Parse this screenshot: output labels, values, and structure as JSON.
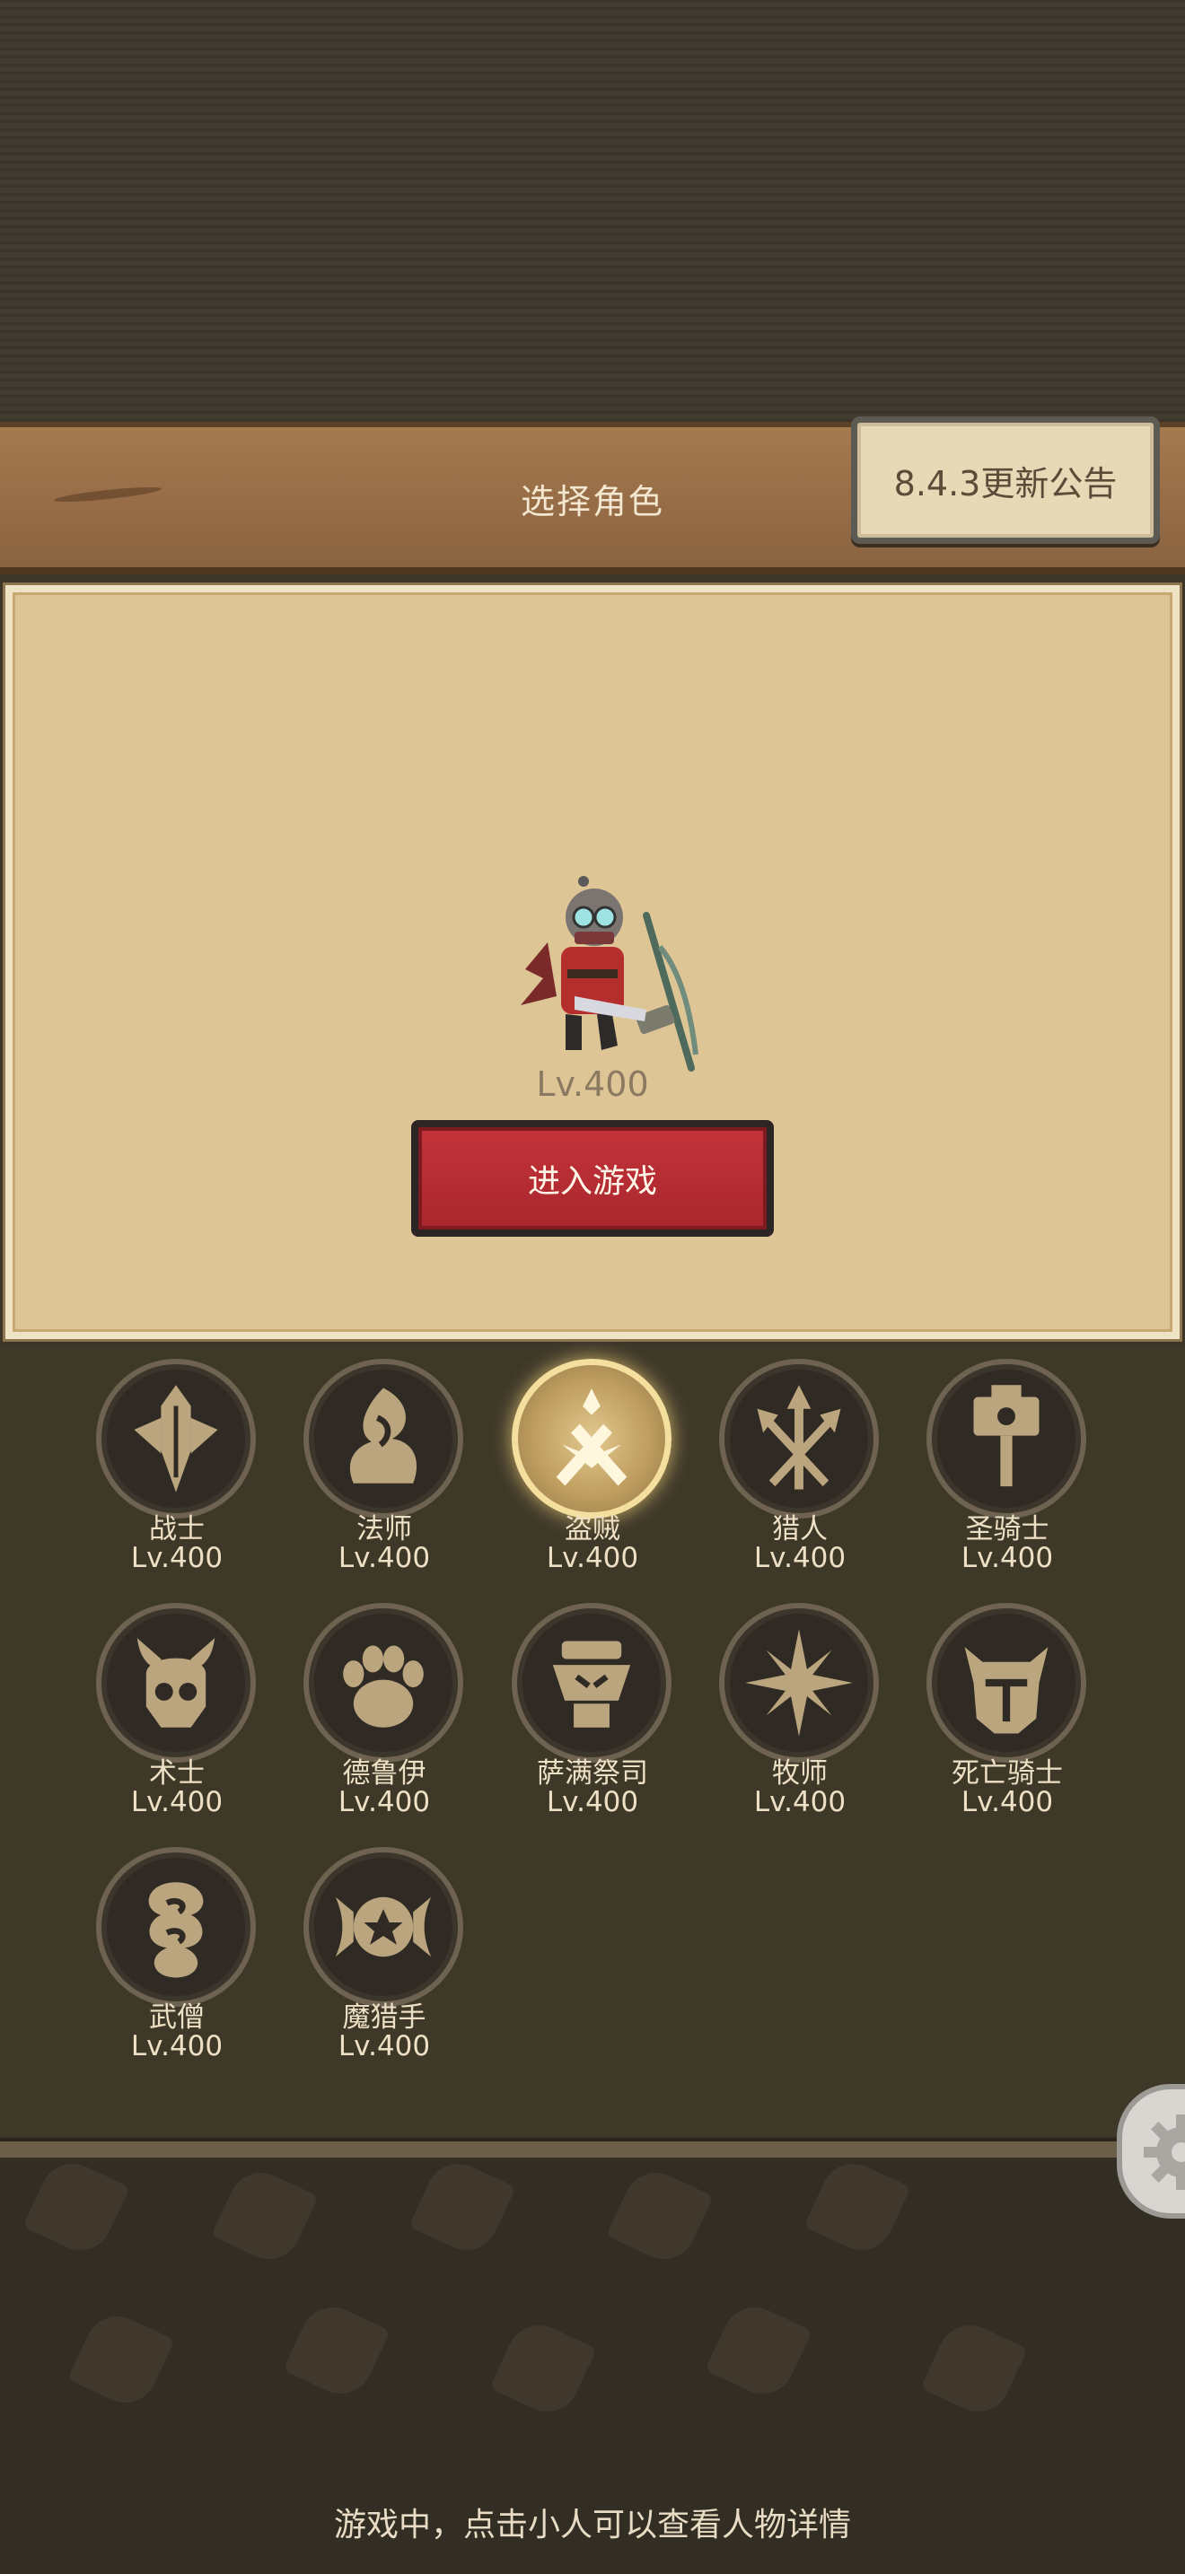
{
  "header": {
    "title": "选择角色",
    "notice_button": "8.4.3更新公告"
  },
  "selected_character": {
    "level": "Lv.400",
    "enter_button": "进入游戏"
  },
  "classes": [
    {
      "name": "战士",
      "level": "Lv.400",
      "icon": "sword-diamond-icon"
    },
    {
      "name": "法师",
      "level": "Lv.400",
      "icon": "flame-dragon-icon"
    },
    {
      "name": "盗贼",
      "level": "Lv.400",
      "icon": "crossed-daggers-icon",
      "selected": true
    },
    {
      "name": "猎人",
      "level": "Lv.400",
      "icon": "crossed-arrows-icon"
    },
    {
      "name": "圣骑士",
      "level": "Lv.400",
      "icon": "hammer-icon"
    },
    {
      "name": "术士",
      "level": "Lv.400",
      "icon": "horned-skull-icon"
    },
    {
      "name": "德鲁伊",
      "level": "Lv.400",
      "icon": "paw-icon"
    },
    {
      "name": "萨满祭司",
      "level": "Lv.400",
      "icon": "totem-icon"
    },
    {
      "name": "牧师",
      "level": "Lv.400",
      "icon": "star-burst-icon"
    },
    {
      "name": "死亡骑士",
      "level": "Lv.400",
      "icon": "helmet-icon"
    },
    {
      "name": "武僧",
      "level": "Lv.400",
      "icon": "swirl-icon"
    },
    {
      "name": "魔猎手",
      "level": "Lv.400",
      "icon": "demon-star-icon"
    }
  ],
  "footer": {
    "tip": "游戏中，点击小人可以查看人物详情",
    "settings_icon": "gear-icon"
  },
  "colors": {
    "background": "#3c3629",
    "panel": "#dec595",
    "header_wood": "#9a7049",
    "enter_button": "#b52b32",
    "selected_glow": "#f4df9e"
  }
}
